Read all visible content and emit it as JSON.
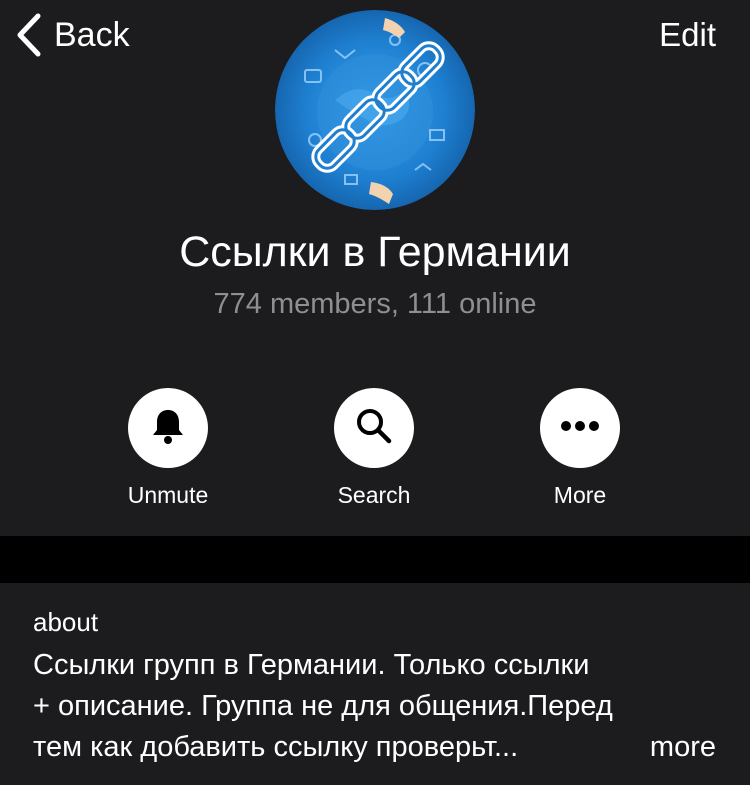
{
  "nav": {
    "back_label": "Back",
    "edit_label": "Edit"
  },
  "group": {
    "title": "Ссылки в Германии",
    "subtitle": "774 members, 111 online"
  },
  "actions": [
    {
      "label": "Unmute",
      "icon": "bell-icon"
    },
    {
      "label": "Search",
      "icon": "search-icon"
    },
    {
      "label": "More",
      "icon": "ellipsis-icon"
    }
  ],
  "about": {
    "label": "about",
    "lines": [
      "Ссылки групп в Германии. Только ссылки",
      "+ описание. Группа не для общения.Перед",
      "тем как добавить ссылку проверьт..."
    ],
    "more_label": "more"
  },
  "colors": {
    "background": "#1c1c1e",
    "separator": "#000000",
    "secondary_text": "#8e8e93",
    "avatar_blue": "#1e7fd0"
  }
}
